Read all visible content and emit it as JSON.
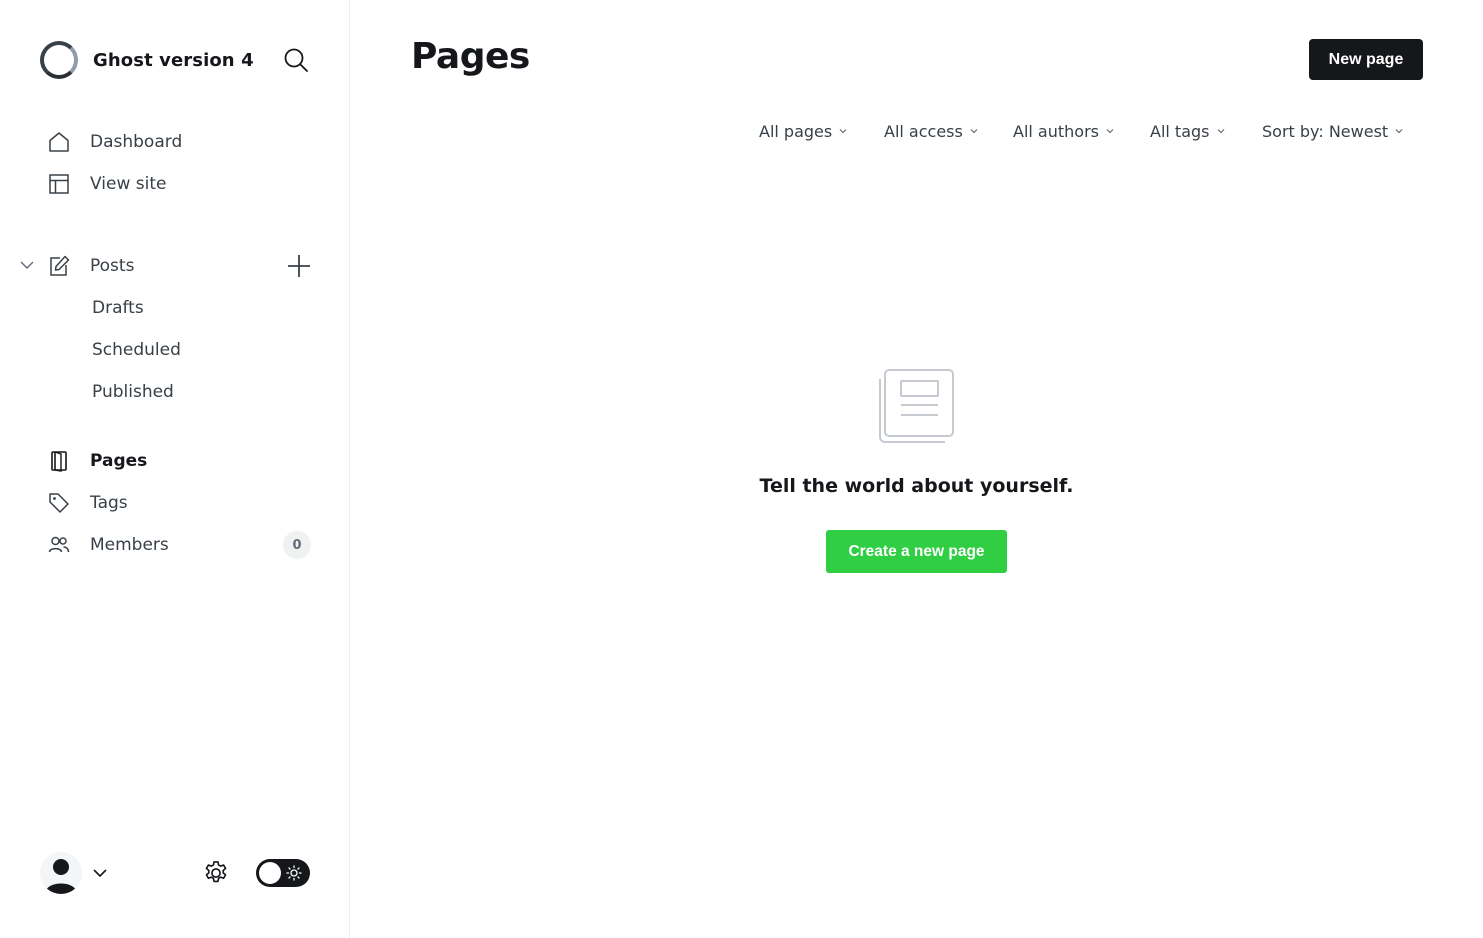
{
  "sidebar": {
    "brand_name": "Ghost version 4",
    "nav": {
      "dashboard": "Dashboard",
      "view_site": "View site",
      "posts": "Posts",
      "drafts": "Drafts",
      "scheduled": "Scheduled",
      "published": "Published",
      "pages": "Pages",
      "tags": "Tags",
      "members": "Members",
      "members_count": "0"
    }
  },
  "main": {
    "title": "Pages",
    "new_button": "New page",
    "filters": {
      "type": "All pages",
      "access": "All access",
      "authors": "All authors",
      "tags": "All tags",
      "sort": "Sort by: Newest"
    },
    "empty_state": {
      "message": "Tell the world about yourself.",
      "cta": "Create a new page"
    }
  },
  "colors": {
    "accent_green": "#30cf43",
    "primary_dark": "#15171a",
    "text_muted": "#394047"
  },
  "icons": [
    "ghost-logo-icon",
    "search-icon",
    "home-icon",
    "layout-icon",
    "edit-icon",
    "plus-icon",
    "page-icon",
    "tag-icon",
    "members-icon",
    "gear-icon",
    "sun-icon",
    "chevron-down-icon",
    "empty-pages-icon"
  ]
}
